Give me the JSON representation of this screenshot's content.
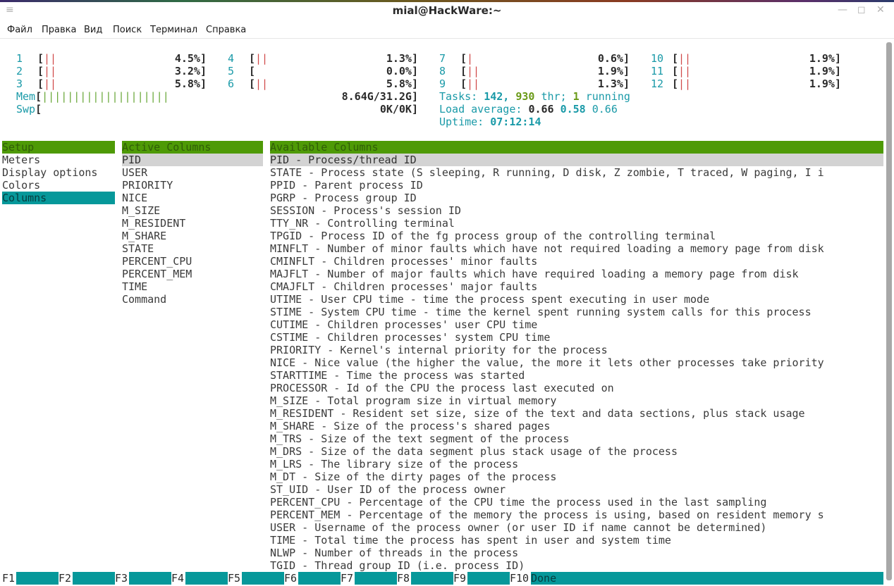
{
  "window": {
    "title": "mial@HackWare:~",
    "menu_icon": "hamburger-icon",
    "controls": [
      "minimize-icon",
      "maximize-icon",
      "close-icon"
    ]
  },
  "menubar": [
    "Файл",
    "Правка",
    "Вид",
    "Поиск",
    "Терминал",
    "Справка"
  ],
  "meters": {
    "cpus": [
      {
        "num": "1",
        "bars": "||",
        "pct": "4.5%]"
      },
      {
        "num": "2",
        "bars": "||",
        "pct": "3.2%]"
      },
      {
        "num": "3",
        "bars": "||",
        "pct": "5.8%]"
      },
      {
        "num": "4",
        "bars": "||",
        "pct": "1.3%]"
      },
      {
        "num": "5",
        "bars": "",
        "pct": "0.0%]"
      },
      {
        "num": "6",
        "bars": "||",
        "pct": "5.8%]"
      },
      {
        "num": "7",
        "bars": "|",
        "pct": "0.6%]"
      },
      {
        "num": "8",
        "bars": "||",
        "pct": "1.9%]"
      },
      {
        "num": "9",
        "bars": "||",
        "pct": "1.3%]"
      },
      {
        "num": "10",
        "bars": "||",
        "pct": "1.9%]"
      },
      {
        "num": "11",
        "bars": "||",
        "pct": "1.9%]"
      },
      {
        "num": "12",
        "bars": "||",
        "pct": "1.9%]"
      }
    ],
    "mem_label": "Mem",
    "mem_bars": "||||||||||||||||||||",
    "mem_value": "8.64G/31.2G]",
    "swp_label": "Swp",
    "swp_value": "0K/0K]",
    "tasks_label": "Tasks:",
    "tasks_count": "142,",
    "threads_count": "930",
    "threads_label": "thr;",
    "running_count": "1",
    "running_label": "running",
    "load_label": "Load average:",
    "load1": "0.66",
    "load5": "0.58",
    "load15": "0.66",
    "uptime_label": "Uptime:",
    "uptime": "07:12:14"
  },
  "setup": {
    "header": "Setup",
    "items": [
      "Meters",
      "Display options",
      "Colors",
      "Columns"
    ],
    "selected": "Columns"
  },
  "active_columns": {
    "header": "Active Columns",
    "items": [
      "PID",
      "USER",
      "PRIORITY",
      "NICE",
      "M_SIZE",
      "M_RESIDENT",
      "M_SHARE",
      "STATE",
      "PERCENT_CPU",
      "PERCENT_MEM",
      "TIME",
      "Command"
    ]
  },
  "available_columns": {
    "header": "Available Columns",
    "items": [
      "PID - Process/thread ID",
      "STATE - Process state (S sleeping, R running, D disk, Z zombie, T traced, W paging, I i",
      "PPID - Parent process ID",
      "PGRP - Process group ID",
      "SESSION - Process's session ID",
      "TTY_NR - Controlling terminal",
      "TPGID - Process ID of the fg process group of the controlling terminal",
      "MINFLT - Number of minor faults which have not required loading a memory page from disk",
      "CMINFLT - Children processes' minor faults",
      "MAJFLT - Number of major faults which have required loading a memory page from disk",
      "CMAJFLT - Children processes' major faults",
      "UTIME - User CPU time - time the process spent executing in user mode",
      "STIME - System CPU time - time the kernel spent running system calls for this process",
      "CUTIME - Children processes' user CPU time",
      "CSTIME - Children processes' system CPU time",
      "PRIORITY - Kernel's internal priority for the process",
      "NICE - Nice value (the higher the value, the more it lets other processes take priority",
      "STARTTIME - Time the process was started",
      "PROCESSOR - Id of the CPU the process last executed on",
      "M_SIZE - Total program size in virtual memory",
      "M_RESIDENT - Resident set size, size of the text and data sections, plus stack usage",
      "M_SHARE - Size of the process's shared pages",
      "M_TRS - Size of the text segment of the process",
      "M_DRS - Size of the data segment plus stack usage of the process",
      "M_LRS - The library size of the process",
      "M_DT - Size of the dirty pages of the process",
      "ST_UID - User ID of the process owner",
      "PERCENT_CPU - Percentage of the CPU time the process used in the last sampling",
      "PERCENT_MEM - Percentage of the memory the process is using, based on resident memory s",
      "USER - Username of the process owner (or user ID if name cannot be determined)",
      "TIME - Total time the process has spent in user and system time",
      "NLWP - Number of threads in the process",
      "TGID - Thread group ID (i.e. process ID)"
    ]
  },
  "function_keys": [
    {
      "key": "F1",
      "label": ""
    },
    {
      "key": "F2",
      "label": ""
    },
    {
      "key": "F3",
      "label": ""
    },
    {
      "key": "F4",
      "label": ""
    },
    {
      "key": "F5",
      "label": ""
    },
    {
      "key": "F6",
      "label": ""
    },
    {
      "key": "F7",
      "label": ""
    },
    {
      "key": "F8",
      "label": ""
    },
    {
      "key": "F9",
      "label": ""
    },
    {
      "key": "F10",
      "label": "Done"
    }
  ]
}
